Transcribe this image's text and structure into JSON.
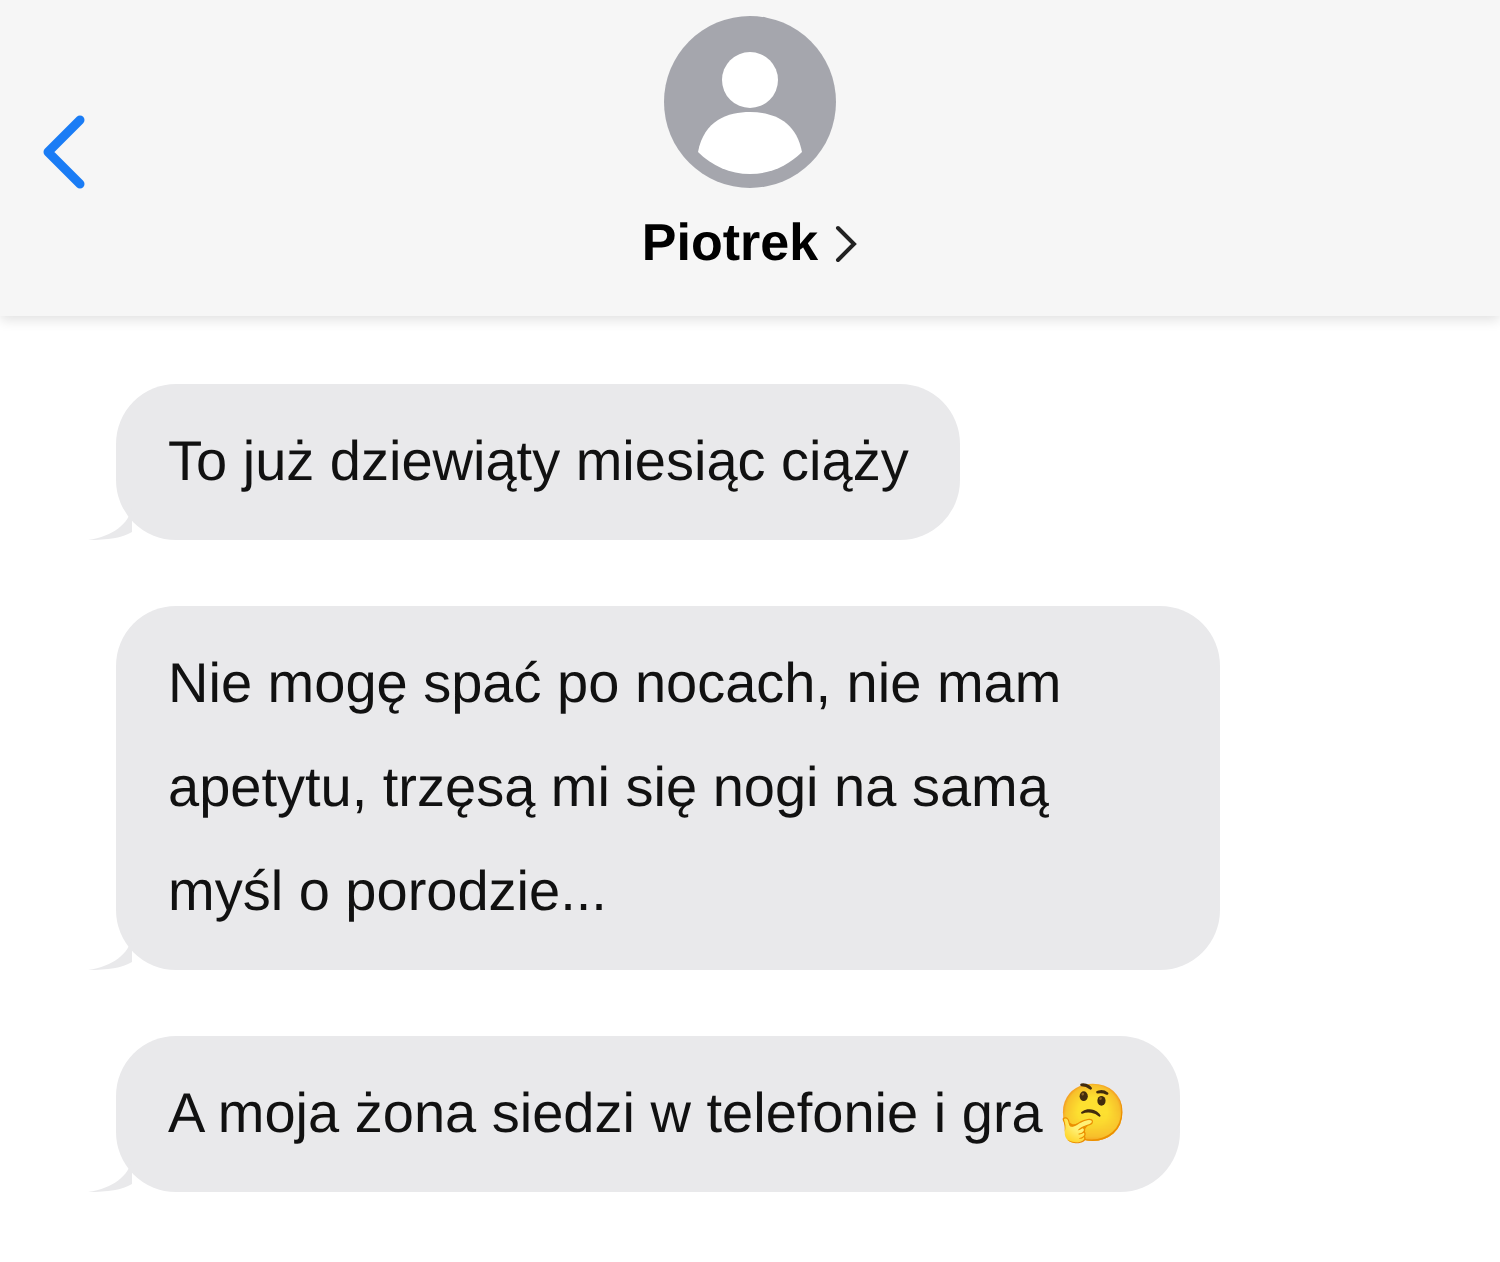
{
  "header": {
    "contact_name": "Piotrek"
  },
  "messages": [
    {
      "text": "To już dziewiąty miesiąc ciąży"
    },
    {
      "text": "Nie mogę spać po nocach, nie mam apetytu, trzęsą mi się nogi na samą myśl o porodzie..."
    },
    {
      "text": "A moja żona siedzi w telefonie i gra 🤔"
    }
  ]
}
